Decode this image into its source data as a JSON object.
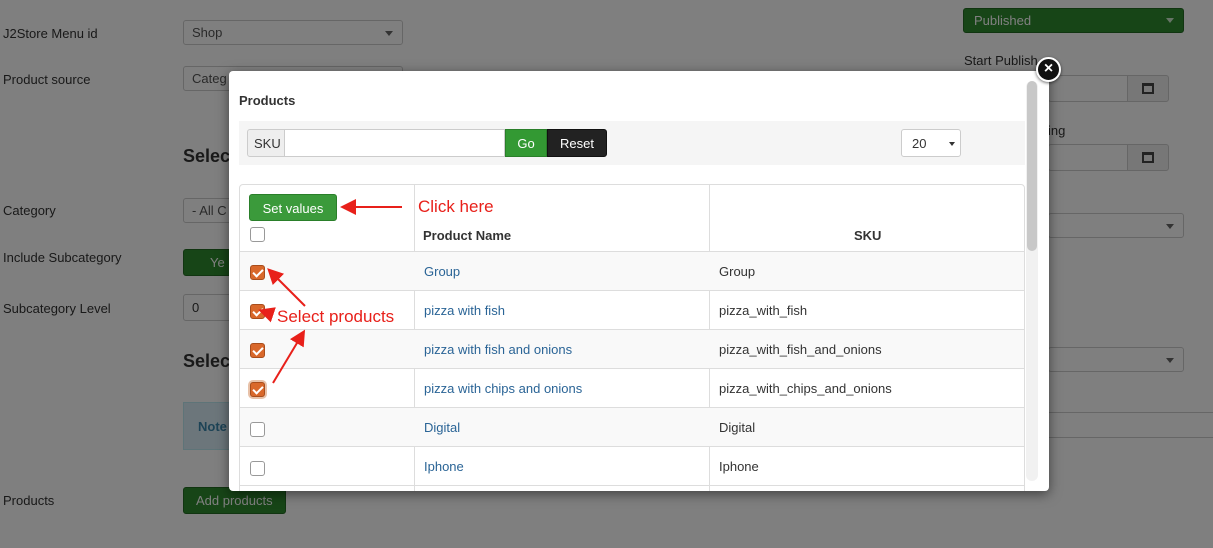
{
  "background": {
    "labels": {
      "menu_id": "J2Store Menu id",
      "product_source": "Product source",
      "category": "Category",
      "include_subcategory": "Include Subcategory",
      "subcategory_level": "Subcategory Level",
      "products": "Products"
    },
    "menu_id_value": "Shop",
    "product_source_value": "Categ",
    "category_value": "- All C",
    "include_subcategory_value": "Ye",
    "subcategory_level_value": "0",
    "heading_1": "Selec",
    "heading_2": "Selec",
    "note_text": "Note",
    "add_products_label": "Add products",
    "status_value": "Published",
    "start_publishing_label": "Start Publish",
    "finish_publishing_label": "ing"
  },
  "modal": {
    "title": "Products",
    "sku_label": "SKU",
    "sku_value": "",
    "go_label": "Go",
    "reset_label": "Reset",
    "limit_value": "20",
    "set_values_label": "Set values",
    "columns": {
      "name": "Product Name",
      "sku": "SKU"
    },
    "rows": [
      {
        "name": "Group",
        "sku": "Group",
        "checked": true
      },
      {
        "name": "pizza with fish",
        "sku": "pizza_with_fish",
        "checked": true
      },
      {
        "name": "pizza with fish and onions",
        "sku": "pizza_with_fish_and_onions",
        "checked": true
      },
      {
        "name": "pizza with chips and onions",
        "sku": "pizza_with_chips_and_onions",
        "checked": true
      },
      {
        "name": "Digital",
        "sku": "Digital",
        "checked": false
      },
      {
        "name": "Iphone",
        "sku": "Iphone",
        "checked": false
      }
    ]
  },
  "annotations": {
    "click_here": "Click here",
    "select_products": "Select products"
  },
  "icons": {
    "close": "close-icon",
    "calendar": "calendar-icon",
    "dropdown": "chevron-down-icon"
  },
  "colors": {
    "annotation": "#e8201a",
    "primary_green": "#339933",
    "checkbox_checked": "#d9682b",
    "link": "#2a6496"
  }
}
